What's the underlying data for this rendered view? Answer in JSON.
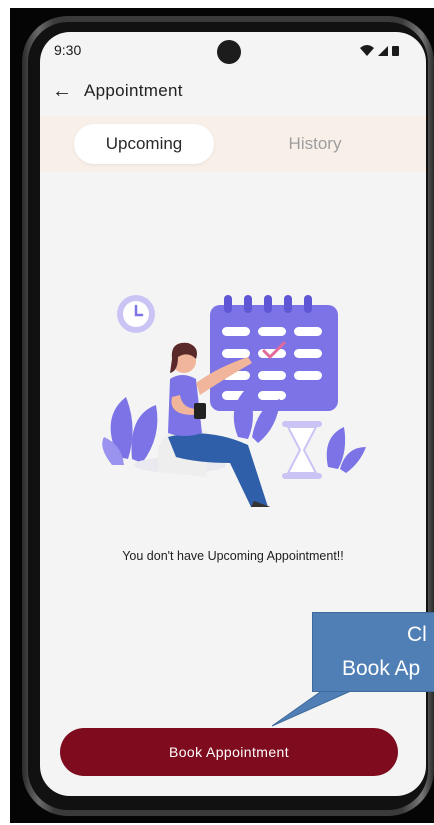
{
  "status_bar": {
    "time": "9:30"
  },
  "header": {
    "title": "Appointment"
  },
  "tabs": [
    {
      "label": "Upcoming",
      "active": true
    },
    {
      "label": "History",
      "active": false
    }
  ],
  "empty_state": {
    "message": "You don't have Upcoming Appointment!!",
    "illustration": "woman-calendar-illustration"
  },
  "actions": {
    "book_label": "Book Appointment"
  },
  "callout": {
    "line1": "Cl",
    "line2": "Book Ap"
  },
  "colors": {
    "primary": "#7f0b1e",
    "tab_bar_bg": "#f7efe8",
    "screen_bg": "#f4f4f4",
    "illustration_purple": "#7b73e6",
    "callout_bg": "#4f7fb5"
  }
}
